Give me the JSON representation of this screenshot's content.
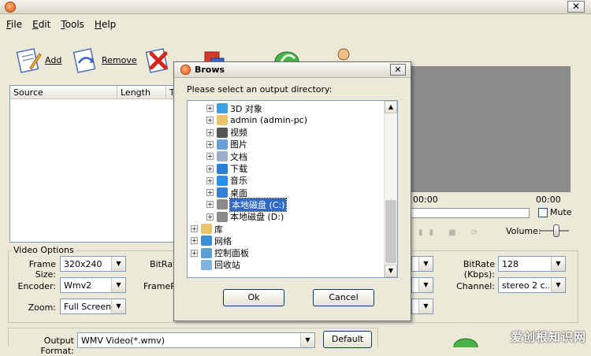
{
  "menu": {
    "file": "File",
    "edit": "Edit",
    "tools": "Tools",
    "help": "Help"
  },
  "toolbar": {
    "add": "Add",
    "remove": "Remove"
  },
  "file_list": {
    "columns": [
      "Source",
      "Length",
      "T"
    ]
  },
  "player": {
    "time_left": "00:00",
    "time_right": "00:00",
    "mute_label": "Mute",
    "volume_label": "Volume:"
  },
  "video_options": {
    "legend": "Video Options",
    "frame_size_label": "Frame Size:",
    "frame_size_value": "320x240",
    "encoder_label": "Encoder:",
    "encoder_value": "Wmv2",
    "zoom_label": "Zoom:",
    "zoom_value": "Full Screen",
    "bitrate_label": "BitRat",
    "framerate_label": "FrameR",
    "audio_bitrate_label": "BitRate (Kbps):",
    "audio_bitrate_value": "128",
    "channel_label": "Channel:",
    "channel_value": "stereo 2 c..."
  },
  "output": {
    "label": "Output Format:",
    "value": "WMV Video(*.wmv)",
    "default_button": "Default"
  },
  "watermark": "爱创根知识网",
  "dialog": {
    "title": "Brows",
    "close_glyph": "✕",
    "prompt": "Please select an output directory:",
    "tree": [
      {
        "label": "3D 对象",
        "icon": "cube-3d-icon",
        "indent": 1,
        "selected": false
      },
      {
        "label": "admin (admin-pc)",
        "icon": "user-folder-icon",
        "indent": 1,
        "selected": false
      },
      {
        "label": "视频",
        "icon": "video-folder-icon",
        "indent": 1,
        "selected": false
      },
      {
        "label": "图片",
        "icon": "picture-folder-icon",
        "indent": 1,
        "selected": false
      },
      {
        "label": "文档",
        "icon": "document-folder-icon",
        "indent": 1,
        "selected": false
      },
      {
        "label": "下载",
        "icon": "download-arrow-icon",
        "indent": 1,
        "selected": false
      },
      {
        "label": "音乐",
        "icon": "music-note-icon",
        "indent": 1,
        "selected": false
      },
      {
        "label": "桌面",
        "icon": "desktop-icon",
        "indent": 1,
        "selected": false
      },
      {
        "label": "本地磁盘 (C:)",
        "icon": "hard-drive-icon",
        "indent": 1,
        "selected": true
      },
      {
        "label": "本地磁盘 (D:)",
        "icon": "hard-drive-icon",
        "indent": 1,
        "selected": false
      },
      {
        "label": "库",
        "icon": "library-folder-icon",
        "indent": 0,
        "selected": false
      },
      {
        "label": "网络",
        "icon": "network-icon",
        "indent": 0,
        "selected": false
      },
      {
        "label": "控制面板",
        "icon": "control-panel-icon",
        "indent": 0,
        "selected": false
      },
      {
        "label": "回收站",
        "icon": "recycle-bin-icon",
        "indent": 0,
        "selected": false
      }
    ],
    "ok_button": "Ok",
    "cancel_button": "Cancel"
  }
}
